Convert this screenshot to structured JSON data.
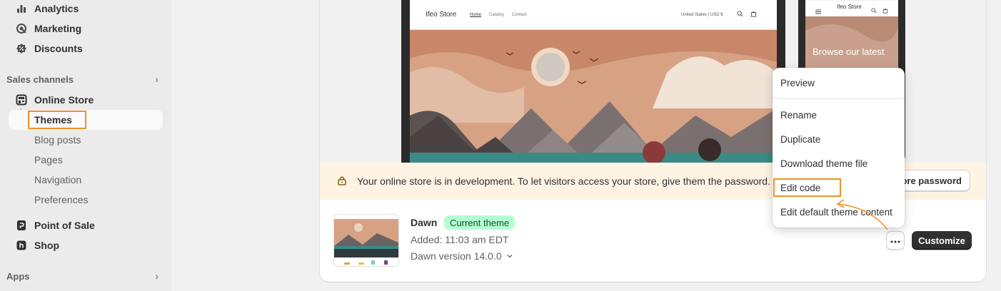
{
  "sidebar": {
    "top_items": [
      {
        "label": "Analytics",
        "icon": "bar-chart-icon"
      },
      {
        "label": "Marketing",
        "icon": "target-icon"
      },
      {
        "label": "Discounts",
        "icon": "discount-icon"
      }
    ],
    "sales_channels": {
      "heading": "Sales channels",
      "online_store": "Online Store",
      "sub_items": [
        "Themes",
        "Blog posts",
        "Pages",
        "Navigation",
        "Preferences"
      ],
      "active": "Themes"
    },
    "point_of_sale": "Point of Sale",
    "shop": "Shop",
    "apps_heading": "Apps"
  },
  "preview": {
    "store_name": "Ifeo Store",
    "nav_links": [
      "Home",
      "Catalog",
      "Contact"
    ],
    "locale": "United States | USD $",
    "mobile_store_name": "Ifeo Store",
    "mobile_hero_text": "Browse our latest"
  },
  "banner": {
    "message": "Your online store is in development. To let visitors access your store, give them the password.",
    "button_label": "store password"
  },
  "theme": {
    "name": "Dawn",
    "badge": "Current theme",
    "added": "Added: 11:03 am EDT",
    "version": "Dawn version 14.0.0",
    "customize_label": "Customize"
  },
  "menu": {
    "items": [
      "Preview",
      "Rename",
      "Duplicate",
      "Download theme file",
      "Edit code",
      "Edit default theme content"
    ],
    "highlighted": "Edit code"
  },
  "colors": {
    "highlight_orange": "#f0902a",
    "badge_green": "#b4fed2",
    "banner_bg": "#fff4e4"
  }
}
